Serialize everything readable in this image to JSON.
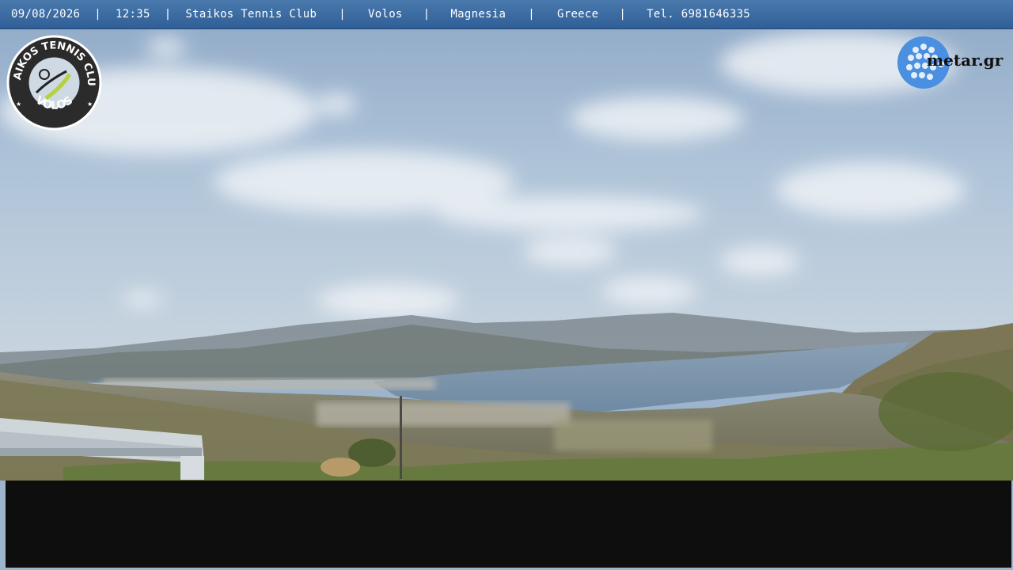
{
  "header": {
    "date": "09/08/2026",
    "time": "12:35",
    "club": "Staikos Tennis Club",
    "city": "Volos",
    "region": "Magnesia",
    "country": "Greece",
    "phone": "Tel. 6981646335",
    "separator": "|"
  },
  "logo": {
    "top_text": "STAIKOS TENNIS CLUB",
    "bottom_text": "VOLOS"
  },
  "metar": {
    "text": "metar.gr"
  },
  "colors": {
    "header_bg": "#3b6aa2",
    "sky_top": "#8fa9c6",
    "sea": "#7a93a8",
    "black_overlay": "#0e0e0e"
  }
}
